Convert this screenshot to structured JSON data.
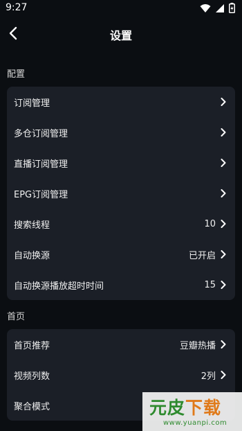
{
  "status_bar": {
    "time": "9:27",
    "icons": [
      "wifi-icon",
      "signal-icon",
      "battery-icon"
    ]
  },
  "header": {
    "back_icon": "chevron-left-icon",
    "title": "设置"
  },
  "sections": [
    {
      "label": "配置",
      "items": [
        {
          "label": "订阅管理",
          "value": ""
        },
        {
          "label": "多仓订阅管理",
          "value": ""
        },
        {
          "label": "直播订阅管理",
          "value": ""
        },
        {
          "label": "EPG订阅管理",
          "value": ""
        },
        {
          "label": "搜索线程",
          "value": "10"
        },
        {
          "label": "自动换源",
          "value": "已开启"
        },
        {
          "label": "自动换源播放超时时间",
          "value": "15"
        }
      ]
    },
    {
      "label": "首页",
      "items": [
        {
          "label": "首页推荐",
          "value": "豆瓣热播"
        },
        {
          "label": "视频列数",
          "value": "2列"
        },
        {
          "label": "聚合模式",
          "value": ""
        }
      ]
    }
  ],
  "watermark": {
    "text_chars": [
      "元",
      "皮",
      "下",
      "载"
    ],
    "url": "www.yuanpi.com"
  },
  "colors": {
    "background": "#0b0e12",
    "card": "#1b1f27",
    "text": "#f0f0f0",
    "watermark_green": "#2e8a2e",
    "watermark_orange": "#e07a1a"
  }
}
